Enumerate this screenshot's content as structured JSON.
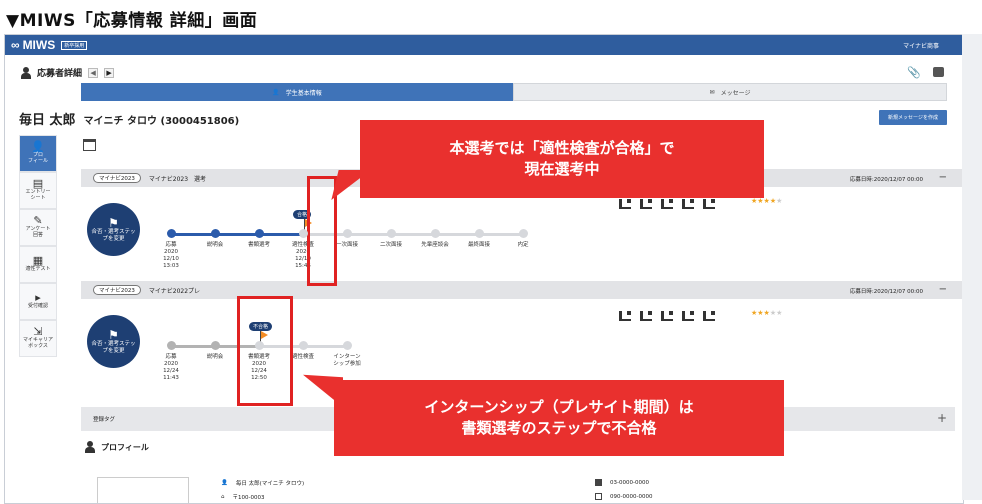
{
  "doc_title": "▼MIWS「応募情報 詳細」画面",
  "app": {
    "logo": "MIWS",
    "logo_badge": "新卒採用",
    "top_right": "マイナビ商事"
  },
  "header": {
    "title": "応募者詳細",
    "nav_prev": "◀",
    "nav_next": "▶"
  },
  "tabs": [
    {
      "label": "学生基本情報"
    },
    {
      "label": "メッセージ"
    }
  ],
  "applicant": {
    "name": "毎日 太郎",
    "kana_id": "マイニチ タロウ (3000451806)"
  },
  "new_message_button": "新規メッセージを作成",
  "sidebar": [
    {
      "icon": "person-icon",
      "label": "プロ\nフィール"
    },
    {
      "icon": "entry-sheet-icon",
      "label": "エントリー\nシート"
    },
    {
      "icon": "survey-icon",
      "label": "アンケート\n回答"
    },
    {
      "icon": "test-icon",
      "label": "適性テスト"
    },
    {
      "icon": "review-icon",
      "label": "受付確認"
    },
    {
      "icon": "career-box-icon",
      "label": "マイキャリア\nボックス"
    }
  ],
  "sections": [
    {
      "pill": "マイナビ2023",
      "title": "マイナビ2023　選考",
      "date": "応募日時:2020/12/07 00:00",
      "toggle": "−",
      "circle_button": "合否・選考ステップを変更",
      "current_badge": "合格",
      "steps": [
        {
          "label": "応募",
          "date": "2020\n12/10\n13:03",
          "state": "done"
        },
        {
          "label": "説明会",
          "date": "",
          "state": "done"
        },
        {
          "label": "書類選考",
          "date": "",
          "state": "done"
        },
        {
          "label": "適性検査",
          "date": "2020\n12/10\n15:45",
          "state": "current"
        },
        {
          "label": "一次面接",
          "date": "",
          "state": "todo"
        },
        {
          "label": "二次面接",
          "date": "",
          "state": "todo"
        },
        {
          "label": "先輩座談会",
          "date": "",
          "state": "todo"
        },
        {
          "label": "最終面接",
          "date": "",
          "state": "todo"
        },
        {
          "label": "内定",
          "date": "",
          "state": "todo"
        }
      ],
      "stars_on": "★★★★",
      "stars_off": "★"
    },
    {
      "pill": "マイナビ2023",
      "title": "マイナビ2022プレ",
      "date": "応募日時:2020/12/07 00:00",
      "toggle": "−",
      "circle_button": "合否・選考ステップを変更",
      "current_badge": "不合格",
      "steps": [
        {
          "label": "応募",
          "date": "2020\n12/24\n11:43",
          "state": "gray"
        },
        {
          "label": "説明会",
          "date": "",
          "state": "gray"
        },
        {
          "label": "書類選考",
          "date": "2020\n12/24\n12:50",
          "state": "current"
        },
        {
          "label": "適性検査",
          "date": "",
          "state": "todo"
        },
        {
          "label": "インターン\nシップ参加",
          "date": "",
          "state": "todo"
        }
      ],
      "stars_on": "★★★",
      "stars_off": "★★"
    }
  ],
  "callouts": [
    {
      "text_line1": "本選考では「適性検査が合格」で",
      "text_line2": "現在選考中",
      "color": "#e9302e"
    },
    {
      "text_line1": "インターンシップ（プレサイト期間）は",
      "text_line2": "書類選考のステップで不合格",
      "color": "#e9302e"
    }
  ],
  "tag_bar": {
    "label": "登録タグ",
    "plus": "+"
  },
  "profile": {
    "heading": "プロフィール",
    "name": "毎日 太郎(マイニチ タロウ)",
    "zip": "〒100-0003",
    "phone": "03-0000-0000",
    "mobile": "090-0000-0000"
  }
}
